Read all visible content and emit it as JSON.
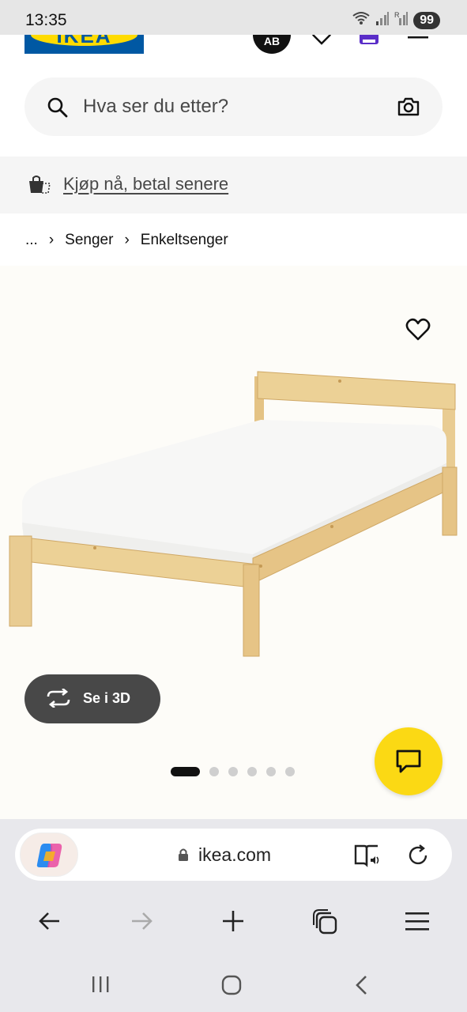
{
  "status_bar": {
    "time": "13:35",
    "icons": [
      "wifi-icon",
      "signal-icon",
      "signal-roaming-icon"
    ],
    "battery": "99"
  },
  "header": {
    "logo_text": "IKEA",
    "avatar_initials": "AB",
    "icons": [
      "heart-icon",
      "shopping-bag-icon",
      "menu-icon"
    ]
  },
  "search": {
    "placeholder": "Hva ser du etter?",
    "icons": [
      "search-icon",
      "camera-icon"
    ]
  },
  "promo": {
    "text": "Kjøp nå, betal senere",
    "icon": "klarna-bag-icon"
  },
  "breadcrumb": {
    "items": [
      "...",
      "Senger",
      "Enkeltsenger"
    ]
  },
  "product": {
    "image": "single bed with pine frame and white mattress",
    "view_3d_label": "Se i 3D",
    "carousel": {
      "total": 6,
      "active": 1
    }
  },
  "browser": {
    "url": "ikea.com",
    "icons": [
      "copilot-icon",
      "lock-icon",
      "reader-mode-icon",
      "reload-icon"
    ]
  },
  "navbar": [
    "back-icon",
    "forward-icon",
    "new-tab-icon",
    "tabs-icon",
    "menu-icon"
  ],
  "system_nav": [
    "recents-icon",
    "home-icon",
    "back-icon"
  ],
  "colors": {
    "ikea_blue": "#0058a3",
    "ikea_yellow": "#ffdb00",
    "chat_yellow": "#fbd914",
    "button_dark": "#484848",
    "status_bar_bg": "#e6e6e6",
    "browser_bar_bg": "#e8e8ec"
  }
}
